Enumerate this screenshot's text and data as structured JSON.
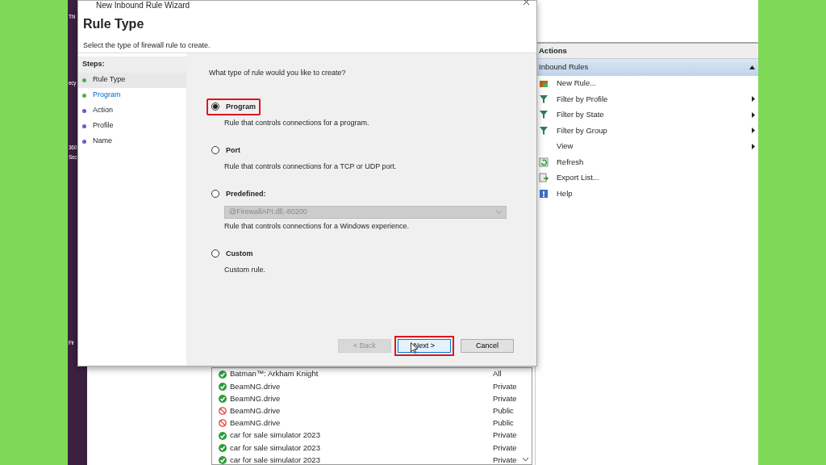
{
  "desktop": {
    "labels": [
      "Thi",
      "ecy",
      "360",
      "Sec",
      "Fir"
    ]
  },
  "wizard": {
    "title": "New Inbound Rule Wizard",
    "heading": "Rule Type",
    "subtitle": "Select the type of firewall rule to create.",
    "steps_label": "Steps:",
    "steps": [
      {
        "label": "Rule Type",
        "selected": true,
        "hover": false,
        "color": "#4caf50"
      },
      {
        "label": "Program",
        "selected": false,
        "hover": true,
        "color": "#4caf50"
      },
      {
        "label": "Action",
        "selected": false,
        "hover": false,
        "color": "#6a5acd"
      },
      {
        "label": "Profile",
        "selected": false,
        "hover": false,
        "color": "#6a5acd"
      },
      {
        "label": "Name",
        "selected": false,
        "hover": false,
        "color": "#6a5acd"
      }
    ],
    "question": "What type of rule would you like to create?",
    "options": [
      {
        "label": "Program",
        "description": "Rule that controls connections for a program.",
        "selected": true,
        "highlighted": true
      },
      {
        "label": "Port",
        "description": "Rule that controls connections for a TCP or UDP port.",
        "selected": false,
        "highlighted": false
      },
      {
        "label": "Predefined:",
        "dropdown": {
          "value": "@FirewallAPI.dll,-80200",
          "disabled": true
        },
        "description": "Rule that controls connections for a Windows experience.",
        "selected": false,
        "highlighted": false
      },
      {
        "label": "Custom",
        "description": "Custom rule.",
        "selected": false,
        "highlighted": false
      }
    ],
    "buttons": [
      {
        "label": "< Back",
        "disabled": true,
        "highlighted": false,
        "cursor": false
      },
      {
        "label": "Next >",
        "disabled": false,
        "highlighted": true,
        "cursor": true
      },
      {
        "label": "Cancel",
        "disabled": false,
        "highlighted": false,
        "cursor": false
      }
    ]
  },
  "actions": {
    "title": "Actions",
    "section": {
      "label": "Inbound Rules",
      "expanded": true
    },
    "items": [
      {
        "label": "New Rule...",
        "kind": "new",
        "submenu": false
      },
      {
        "label": "Filter by Profile",
        "kind": "filter",
        "submenu": true
      },
      {
        "label": "Filter by State",
        "kind": "filter",
        "submenu": true
      },
      {
        "label": "Filter by Group",
        "kind": "filter",
        "submenu": true
      },
      {
        "label": "View",
        "kind": "none",
        "submenu": true
      },
      {
        "label": "Refresh",
        "kind": "refresh",
        "submenu": false
      },
      {
        "label": "Export List...",
        "kind": "export",
        "submenu": false
      },
      {
        "label": "Help",
        "kind": "help",
        "submenu": false
      }
    ]
  },
  "rules": [
    {
      "name": "Batman™: Arkham Knight",
      "profile": "All",
      "enabled": true
    },
    {
      "name": "BeamNG.drive",
      "profile": "Private",
      "enabled": true
    },
    {
      "name": "BeamNG.drive",
      "profile": "Private",
      "enabled": true
    },
    {
      "name": "BeamNG.drive",
      "profile": "Public",
      "enabled": false
    },
    {
      "name": "BeamNG.drive",
      "profile": "Public",
      "enabled": false
    },
    {
      "name": "car for sale simulator 2023",
      "profile": "Private",
      "enabled": true
    },
    {
      "name": "car for sale simulator 2023",
      "profile": "Private",
      "enabled": true
    },
    {
      "name": "car for sale simulator 2023",
      "profile": "Private",
      "enabled": true
    }
  ]
}
